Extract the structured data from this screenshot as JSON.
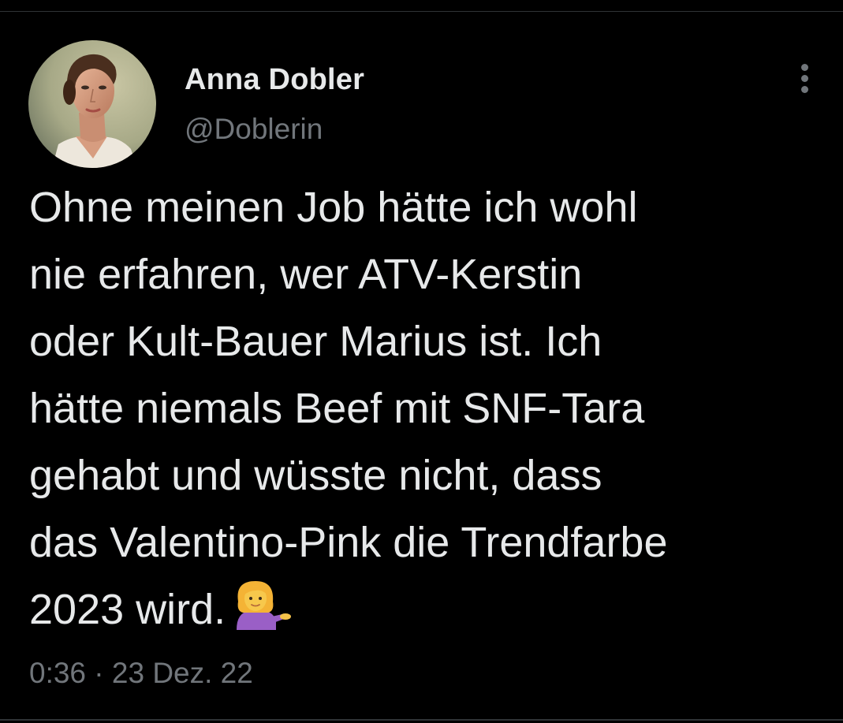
{
  "tweet": {
    "author": {
      "display_name": "Anna Dobler",
      "handle": "@Doblerin",
      "avatar_icon": "avatar-portrait-woman"
    },
    "text_lines": [
      "Ohne meinen Job hätte ich wohl",
      "nie erfahren, wer ATV-Kerstin",
      "oder Kult-Bauer Marius ist. Ich",
      "hätte niemals Beef mit SNF-Tara",
      "gehabt und wüsste nicht, dass",
      "das Valentino-Pink die Trendfarbe",
      "2023 wird."
    ],
    "emoji": "woman-tipping-hand-emoji",
    "timestamp": "0:36 · 23 Dez. 22",
    "more_icon": "more-vertical-icon"
  },
  "colors": {
    "background": "#000000",
    "primary_text": "#e7e9ea",
    "secondary_text": "#71767b",
    "divider": "#2f3336"
  }
}
